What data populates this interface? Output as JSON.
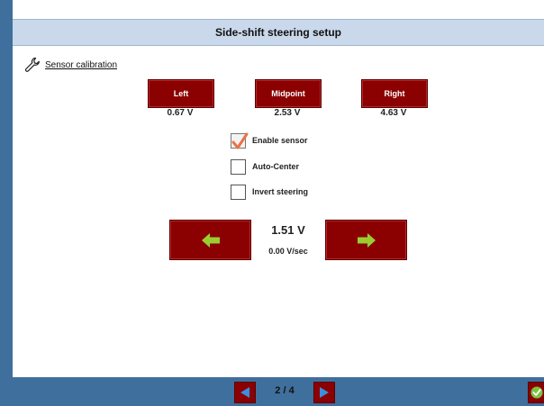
{
  "title": "Side-shift steering setup",
  "section": {
    "label": "Sensor calibration",
    "icon": "wrench-icon"
  },
  "calibration": {
    "buttons": [
      {
        "label": "Left",
        "value": "0.67 V"
      },
      {
        "label": "Midpoint",
        "value": "2.53 V"
      },
      {
        "label": "Right",
        "value": "4.63 V"
      }
    ]
  },
  "options": [
    {
      "label": "Enable sensor",
      "checked": true
    },
    {
      "label": "Auto-Center",
      "checked": false
    },
    {
      "label": "Invert steering",
      "checked": false
    }
  ],
  "steering": {
    "voltage": "1.51 V",
    "rate": "0.00 V/sec",
    "left_icon": "arrow-left-icon",
    "right_icon": "arrow-right-icon"
  },
  "pager": {
    "text": "2 / 4"
  },
  "colors": {
    "frame": "#3f6f9c",
    "title_bar": "#c9d8ea",
    "button": "#8b0000",
    "arrow": "#9acd32",
    "check": "#e8734a"
  }
}
